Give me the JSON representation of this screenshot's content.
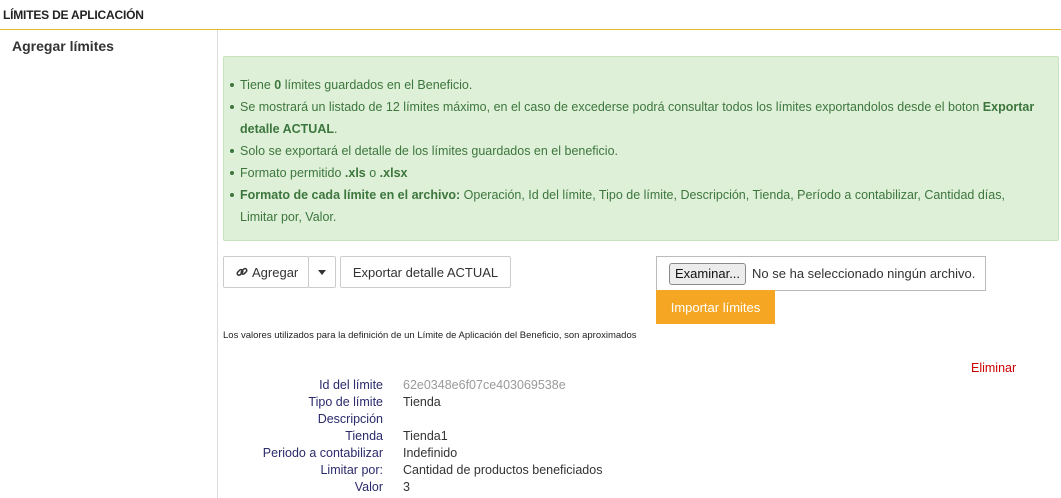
{
  "header": {
    "title": "LÍMITES DE APLICACIÓN"
  },
  "left": {
    "title": "Agregar límites"
  },
  "info": {
    "line1_pre": "Tiene ",
    "line1_count": "0",
    "line1_post": " límites guardados en el Beneficio.",
    "line2_pre": "Se mostrará un listado de 12 límites máximo, en el caso de excederse podrá consultar todos los límites exportandolos desde el boton ",
    "line2_bold": "Exportar detalle ACTUAL",
    "line2_post": ".",
    "line3": "Solo se exportará el detalle de los límites guardados en el beneficio.",
    "line4_pre": "Formato permitido ",
    "line4_xls": ".xls",
    "line4_mid": " o ",
    "line4_xlsx": ".xlsx",
    "line5_bold": "Formato de cada límite en el archivo:",
    "line5_post": " Operación, Id del límite, Tipo de límite, Descripción, Tienda, Período a contabilizar, Cantidad días, Limitar por, Valor."
  },
  "toolbar": {
    "add_label": "Agregar",
    "export_label": "Exportar detalle ACTUAL",
    "browse_label": "Examinar...",
    "no_file_label": "No se ha seleccionado ningún archivo.",
    "import_label": "Importar límites"
  },
  "note": "Los valores utilizados para la definición de un Límite de Aplicación del Beneficio, son aproximados",
  "limit": {
    "delete_label": "Eliminar",
    "fields": [
      {
        "label": "Id del límite",
        "value": "62e0348e6f07ce403069538e"
      },
      {
        "label": "Tipo de límite",
        "value": "Tienda"
      },
      {
        "label": "Descripción",
        "value": ""
      },
      {
        "label": "Tienda",
        "value": "Tienda1"
      },
      {
        "label": "Periodo a contabilizar",
        "value": "Indefinido"
      },
      {
        "label": "Limitar por:",
        "value": "Cantidad de productos beneficiados"
      },
      {
        "label": "Valor",
        "value": "3"
      }
    ]
  },
  "colors": {
    "accent": "#f5a623",
    "info_bg": "#dff0d8",
    "info_text": "#3c763d",
    "danger": "#cc0000",
    "header_rule": "#e0b830"
  }
}
